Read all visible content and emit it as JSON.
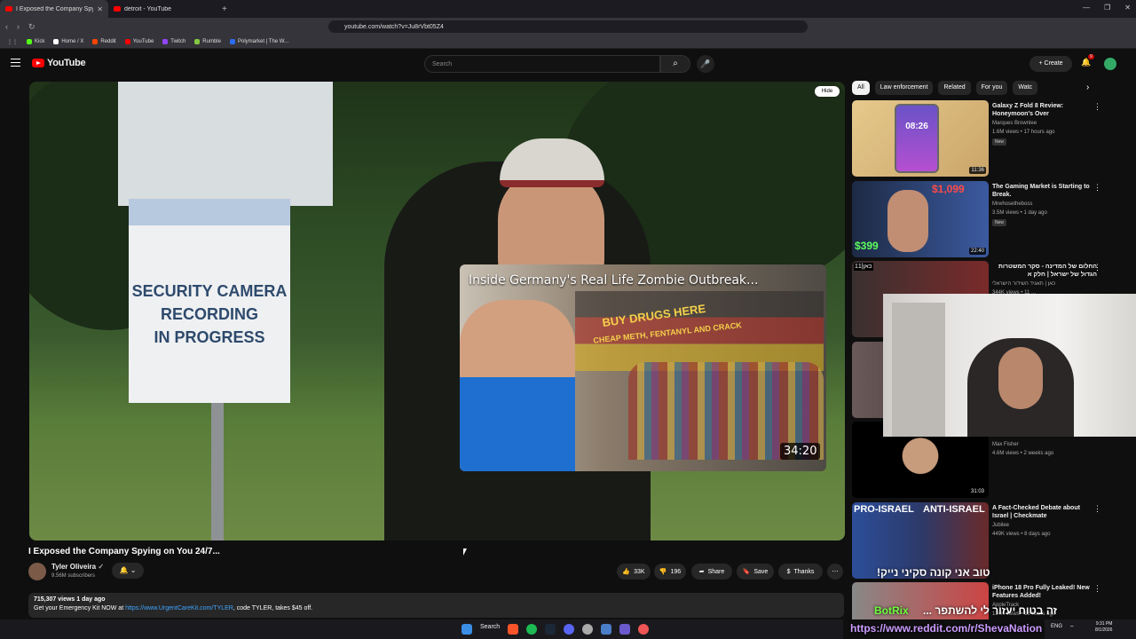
{
  "browser": {
    "tabs": [
      {
        "title": "I Exposed the Company Spyin",
        "active": true
      },
      {
        "title": "detroit - YouTube",
        "active": false
      }
    ],
    "url": "youtube.com/watch?v=Ju8rVbt05Z4",
    "bookmarks": [
      "Kick",
      "Home / X",
      "Reddit",
      "YouTube",
      "Twitch",
      "Rumble",
      "Polymarket | The W..."
    ]
  },
  "youtube": {
    "logo": "YouTube",
    "search_placeholder": "Search",
    "create_label": "Create",
    "notif_count": "9"
  },
  "player": {
    "sign_text": [
      "SECURITY CAMERA",
      "RECORDING",
      "IN PROGRESS"
    ],
    "hide_label": "Hide",
    "popup": {
      "title": "Inside Germany's Real Life Zombie Outbreak...",
      "sign1": "BUY DRUGS HERE",
      "sign2": "CHEAP METH, FENTANYL AND CRACK",
      "duration": "34:20"
    }
  },
  "video": {
    "title": "I Exposed the Company Spying on You 24/7...",
    "channel": "Tyler Oliveira",
    "subscribers": "9.56M subscribers",
    "likes": "33K",
    "dislikes": "196",
    "share": "Share",
    "save": "Save",
    "thanks": "Thanks",
    "views_date": "715,307 views  1 day ago",
    "desc_prefix": "Get your Emergency Kit NOW at ",
    "desc_link": "https://www.UrgentCareKit.com/TYLER",
    "desc_suffix": ", code TYLER, takes $45 off."
  },
  "chips": [
    "All",
    "Law enforcement",
    "Related",
    "For you",
    "Watc"
  ],
  "recommendations": [
    {
      "title": "Galaxy Z Fold 8 Review: Honeymoon's Over",
      "channel": "Marques Brownlee",
      "meta": "1.6M views • 17 hours ago",
      "badge": "New",
      "duration": "11:36"
    },
    {
      "title": "The Gaming Market is Starting to Break.",
      "channel": "Mrwhosetheboss",
      "meta": "3.5M views • 1 day ago",
      "badge": "New",
      "duration": "22:40"
    },
    {
      "title": "החלום של המדינה - סקר המשטרות הגדול של ישראל | חלק א",
      "channel": "כאן | תאגיד השידור הישראלי",
      "meta": "344K views • 11 ...",
      "badge": "",
      "duration": ""
    },
    {
      "title": "",
      "channel": "Max Fisher",
      "meta": "4.6M views • 2 weeks ago",
      "badge": "",
      "duration": "31:03"
    },
    {
      "title": "A Fact-Checked Debate about Israel | Checkmate",
      "channel": "Jubilee",
      "meta": "449K views • 8 days ago",
      "badge": "",
      "duration": ""
    },
    {
      "title": "iPhone 18 Pro Fully Leaked! New Features Added!",
      "channel": "AppleTrack",
      "meta": "124K views • 16 hours ago",
      "badge": "",
      "duration": ""
    }
  ],
  "thumb_texts": {
    "fold_clock": "08:26",
    "gaming_price1": "$1,099",
    "gaming_price2": "$399",
    "israel_left": "PRO-ISRAEL",
    "israel_right": "ANTI-ISRAEL",
    "kan_logo": "11|כאן"
  },
  "overlays": {
    "hebrew1": "טוב אני קונה סקיני נייק!",
    "botrix": "BotRix",
    "hebrew2": "זה בטוח יעזור לי להשתפר ...",
    "reddit": "https://www.reddit.com/r/ShevaNation"
  },
  "taskbar": {
    "search": "Search",
    "lang": "ENG",
    "time": "9:31 PM",
    "date": "8/1/2026"
  }
}
